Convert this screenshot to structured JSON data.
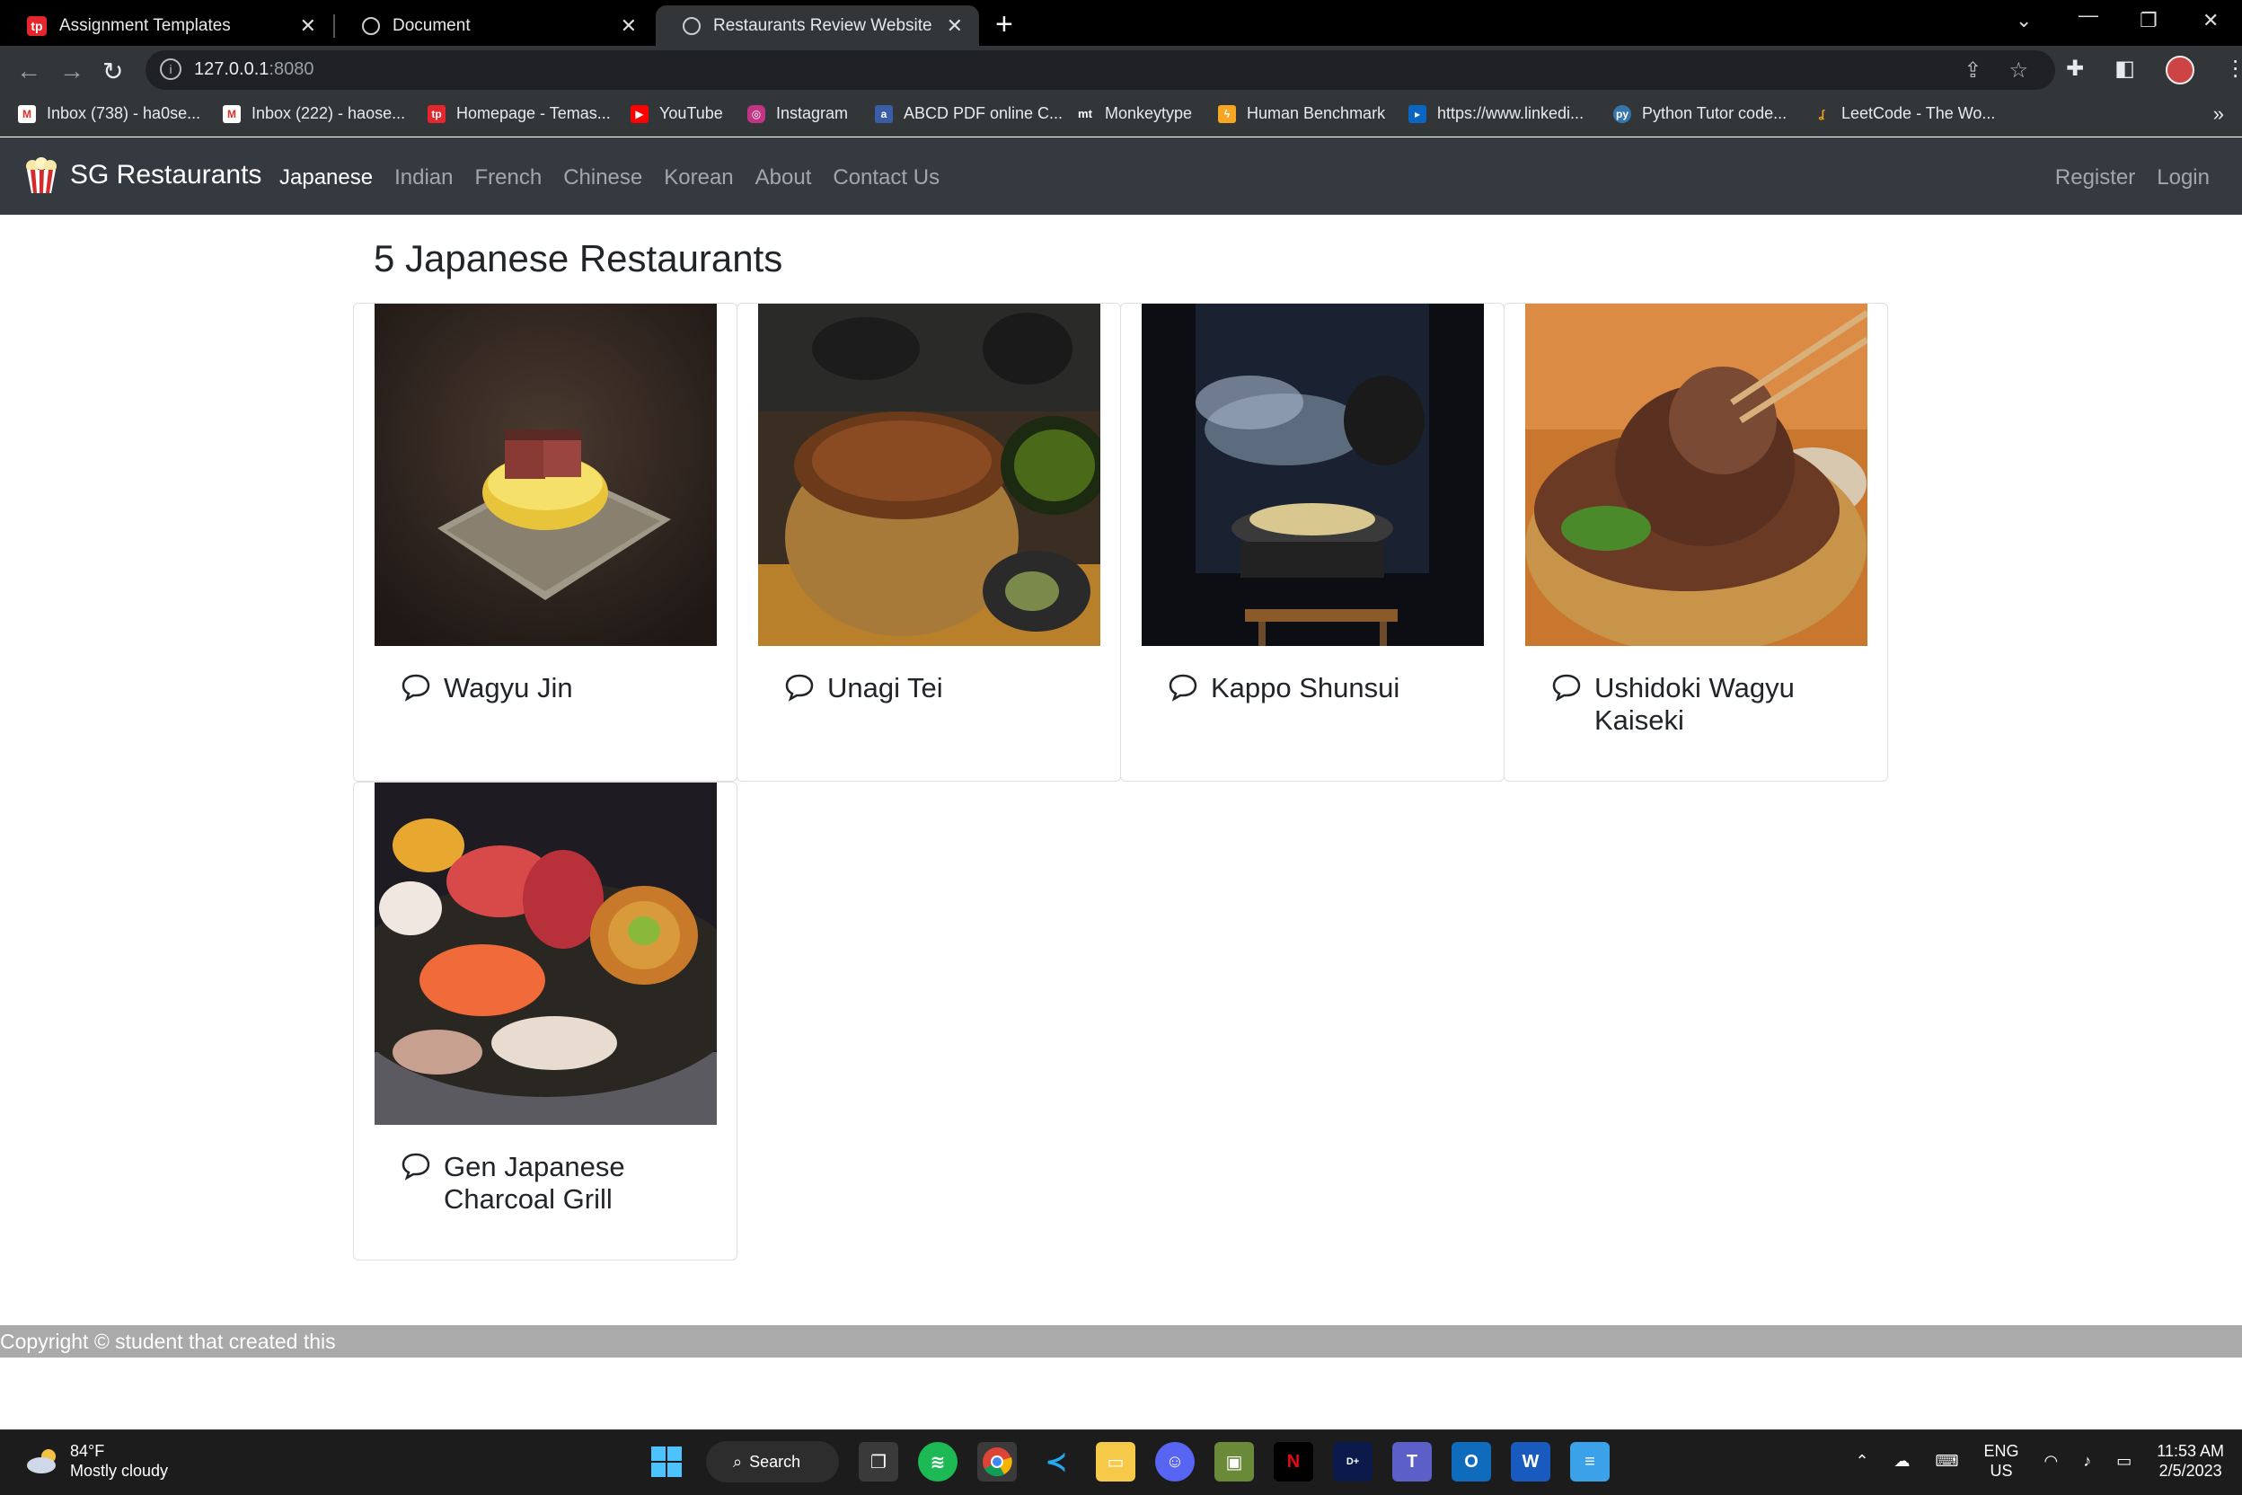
{
  "browser": {
    "tabs": [
      {
        "title": "Assignment Templates",
        "favicon": "tp"
      },
      {
        "title": "Document",
        "favicon": "globe"
      },
      {
        "title": "Restaurants Review Website",
        "favicon": "globe"
      }
    ],
    "url_host": "127.0.0.1",
    "url_port": ":8080",
    "bookmarks": [
      {
        "label": "Inbox (738) - ha0se...",
        "icon": "gmail-icon"
      },
      {
        "label": "Inbox (222) - haose...",
        "icon": "gmail-icon"
      },
      {
        "label": "Homepage - Temas...",
        "icon": "tp-icon"
      },
      {
        "label": "YouTube",
        "icon": "youtube-icon"
      },
      {
        "label": "Instagram",
        "icon": "instagram-icon"
      },
      {
        "label": "ABCD PDF online C...",
        "icon": "pdf-icon"
      },
      {
        "label": "Monkeytype",
        "icon": "monkeytype-icon"
      },
      {
        "label": "Human Benchmark",
        "icon": "lightning-icon"
      },
      {
        "label": "https://www.linkedi...",
        "icon": "linkedin-icon"
      },
      {
        "label": "Python Tutor code...",
        "icon": "python-icon"
      },
      {
        "label": "LeetCode - The Wo...",
        "icon": "leetcode-icon"
      }
    ],
    "bookmarks_more": "»"
  },
  "site": {
    "brand": "SG Restaurants",
    "nav": [
      "Japanese",
      "Indian",
      "French",
      "Chinese",
      "Korean",
      "About",
      "Contact Us"
    ],
    "nav_right": [
      "Register",
      "Login"
    ],
    "page_title": "5 Japanese Restaurants",
    "restaurants": [
      {
        "name": "Wagyu Jin"
      },
      {
        "name": "Unagi Tei"
      },
      {
        "name": "Kappo Shunsui"
      },
      {
        "name": "Ushidoki Wagyu Kaiseki"
      },
      {
        "name": "Gen Japanese Charcoal Grill"
      }
    ],
    "footer": "Copyright © student that created this"
  },
  "taskbar": {
    "temperature": "84°F",
    "weather": "Mostly cloudy",
    "search_label": "Search",
    "lang": "ENG",
    "region": "US",
    "time": "11:53 AM",
    "date": "2/5/2023"
  }
}
